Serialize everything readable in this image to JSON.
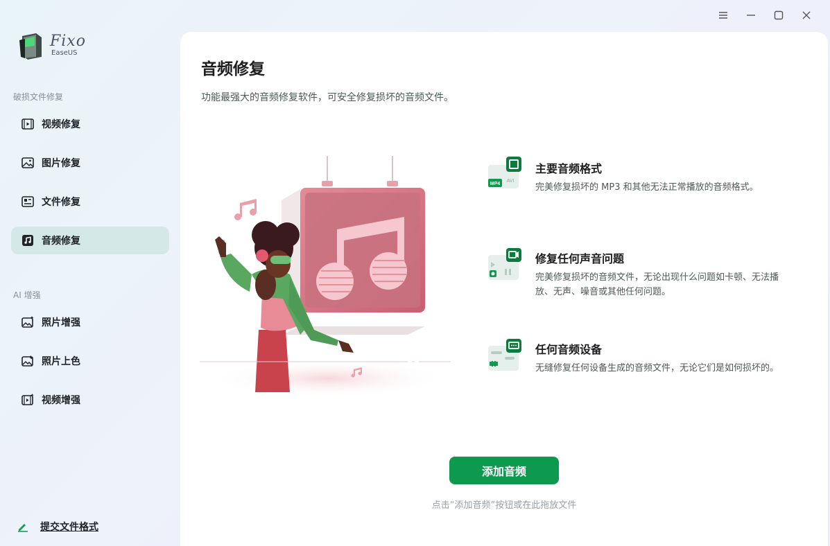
{
  "app": {
    "logo_title": "Fixo",
    "logo_sub": "EaseUS"
  },
  "window_controls": [
    "menu-icon",
    "minimize-icon",
    "maximize-icon",
    "close-icon"
  ],
  "sidebar": {
    "section1_label": "破损文件修复",
    "section1_items": [
      {
        "label": "视频修复",
        "icon": "video-icon"
      },
      {
        "label": "图片修复",
        "icon": "image-icon"
      },
      {
        "label": "文件修复",
        "icon": "document-icon"
      },
      {
        "label": "音频修复",
        "icon": "music-icon",
        "active": true
      }
    ],
    "section2_label": "AI 增强",
    "section2_items": [
      {
        "label": "照片增强",
        "icon": "photo-enhance-icon"
      },
      {
        "label": "照片上色",
        "icon": "photo-colorize-icon"
      },
      {
        "label": "视频增强",
        "icon": "video-enhance-icon"
      }
    ],
    "submit_format": "提交文件格式"
  },
  "main": {
    "title": "音频修复",
    "subtitle": "功能最强大的音频修复软件，可安全修复损坏的音频文件。",
    "features": [
      {
        "title": "主要音频格式",
        "desc": "完美修复损坏的 MP3 和其他无法正常播放的音频格式。",
        "icon_labels": [
          "MP4",
          "AVI"
        ]
      },
      {
        "title": "修复任何声音问题",
        "desc": "完美修复损坏的音频文件，无论出现什么问题如卡顿、无法播放、无声、噪音或其他任何问题。"
      },
      {
        "title": "任何音频设备",
        "desc": "无缝修复任何设备生成的音频文件，无论它们是如何损坏的。"
      }
    ],
    "add_button": "添加音频",
    "hint": "点击“添加音频”按钮或在此拖放文件"
  },
  "colors": {
    "accent": "#0e9a4e",
    "active_nav_bg": "#d4e8e8",
    "illustration_pink": "#e98a97"
  }
}
